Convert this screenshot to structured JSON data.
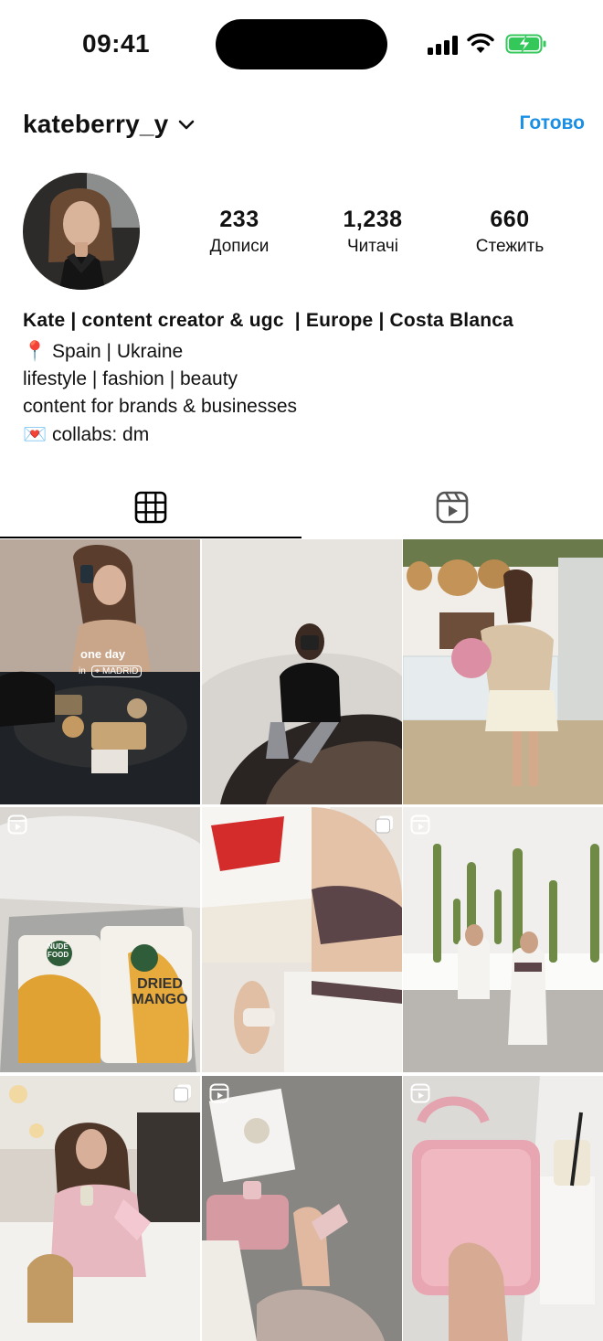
{
  "status_bar": {
    "time": "09:41"
  },
  "header": {
    "username": "kateberry_y",
    "done_label": "Готово"
  },
  "stats": [
    {
      "value": "233",
      "label": "Дописи"
    },
    {
      "value": "1,238",
      "label": "Читачі"
    },
    {
      "value": "660",
      "label": "Стежить"
    }
  ],
  "bio": {
    "name": "Kate | content creator & ugc  | Europe | Costa Blanca",
    "lines": [
      "📍 Spain | Ukraine",
      "lifestyle | fashion | beauty",
      "content for brands & businesses",
      "💌 collabs: dm"
    ]
  },
  "tabs": {
    "active": "grid"
  },
  "posts": [
    {
      "type": "post",
      "overlay_title": "one day",
      "overlay_in": "in",
      "overlay_place": "MADRID"
    },
    {
      "type": "post"
    },
    {
      "type": "post"
    },
    {
      "type": "reel",
      "pack_brand": "NUDE FOOD",
      "pack_title": "DRIED MANGO"
    },
    {
      "type": "carousel"
    },
    {
      "type": "reel"
    },
    {
      "type": "carousel"
    },
    {
      "type": "reel"
    },
    {
      "type": "reel"
    }
  ],
  "colors": {
    "accent": "#1a8fe3",
    "battery": "#34c759"
  }
}
